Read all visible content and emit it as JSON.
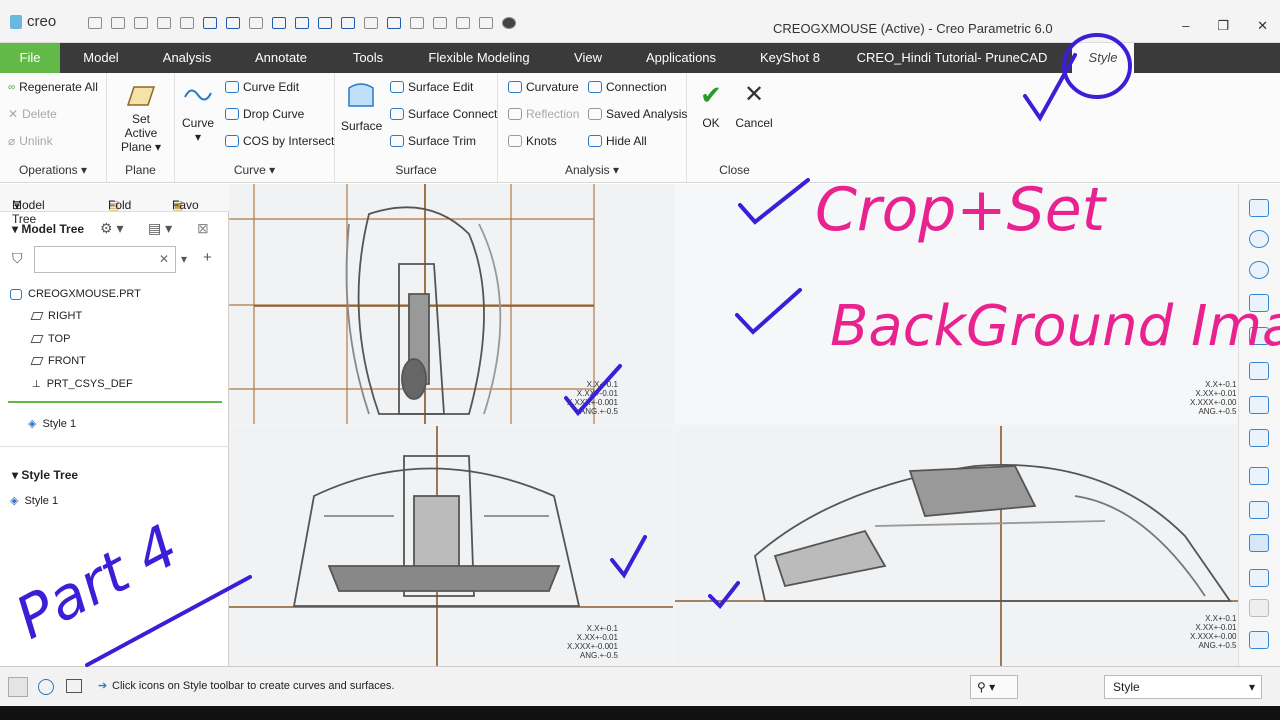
{
  "app": {
    "logo": "creo",
    "window_title": "CREOGXMOUSE (Active) - Creo Parametric 6.0"
  },
  "window_controls": {
    "minimize": "–",
    "maximize": "❐",
    "close": "✕"
  },
  "ribbon_tabs": [
    "File",
    "Model",
    "Analysis",
    "Annotate",
    "Tools",
    "Flexible Modeling",
    "View",
    "Applications",
    "KeyShot 8",
    "CREO_Hindi Tutorial- PruneCAD",
    "Style"
  ],
  "groups": {
    "operations": {
      "label": "Operations ▾",
      "items": [
        "Regenerate All",
        "Delete",
        "Unlink"
      ]
    },
    "plane": {
      "label": "Plane",
      "set_active": "Set Active",
      "plane": "Plane ▾"
    },
    "curve": {
      "label": "Curve ▾",
      "big": "Curve",
      "items": [
        "Curve Edit",
        "Drop Curve",
        "COS by Intersect"
      ]
    },
    "surface": {
      "label": "Surface",
      "big": "Surface",
      "items": [
        "Surface Edit",
        "Surface Connect",
        "Surface Trim"
      ]
    },
    "analysis": {
      "label": "Analysis ▾",
      "items": [
        "Curvature",
        "Reflection",
        "Knots",
        "Connection",
        "Saved Analysis",
        "Hide All"
      ]
    },
    "close": {
      "label": "Close",
      "ok": "OK",
      "cancel": "Cancel"
    }
  },
  "left_panel": {
    "tabs": [
      "Model Tree",
      "Fold",
      "Favo"
    ],
    "model_tree_header": "Model Tree",
    "part": "CREOGXMOUSE.PRT",
    "items": [
      "RIGHT",
      "TOP",
      "FRONT",
      "PRT_CSYS_DEF"
    ],
    "style_feature": "Style 1",
    "style_tree_header": "Style Tree",
    "style_item": "Style 1"
  },
  "viewport": {
    "tolerance_full": [
      "X.X+-0.1",
      "X.XX+-0.01",
      "X.XXX+-0.001",
      "ANG.+-0.5"
    ],
    "tolerance_cut": [
      "X.X+-0.1",
      "X.XX+-0.01",
      "X.XXX+-0.00",
      "ANG.+-0.5"
    ]
  },
  "annotations": {
    "crop_set": "Crop+Set",
    "background": "BackGround Imag",
    "part": "Part 4"
  },
  "status": {
    "message": "Click icons on Style toolbar to create curves and surfaces.",
    "selection_filter": "Style"
  },
  "colors": {
    "file_tab": "#62b948",
    "ribbon_bg": "#3a3a3a",
    "ink_blue": "#3a1fd6",
    "ink_pink": "#e8228f",
    "sketch_line": "#8b5a2b"
  }
}
